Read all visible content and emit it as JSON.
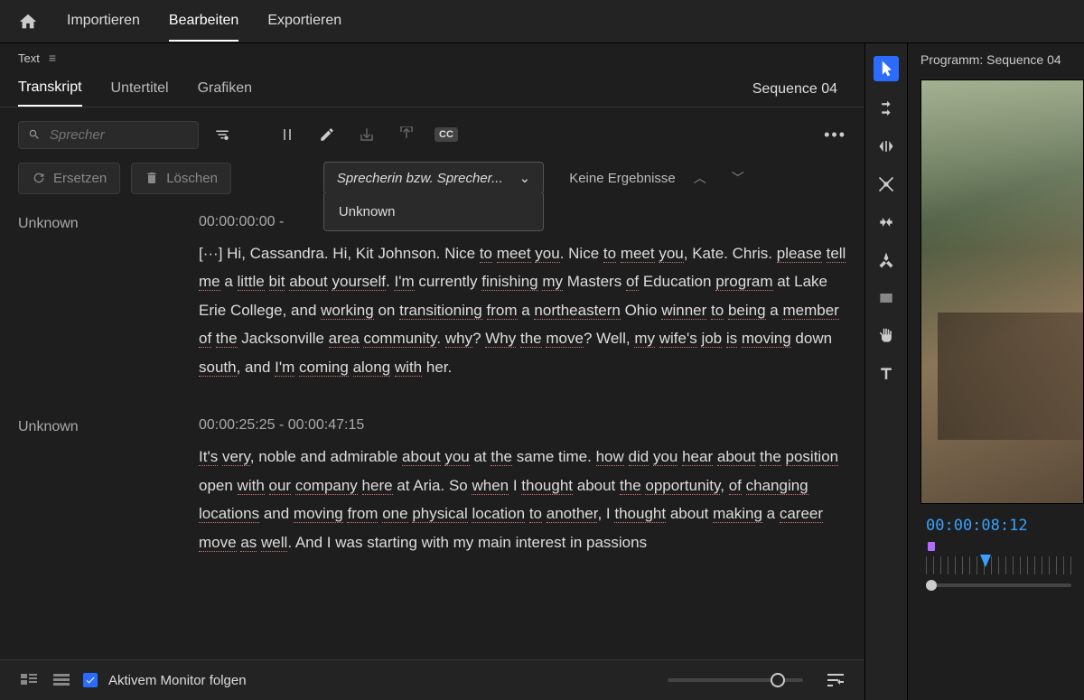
{
  "topbar": {
    "tabs": [
      "Importieren",
      "Bearbeiten",
      "Exportieren"
    ],
    "active": 1
  },
  "panel": {
    "title": "Text",
    "subtabs": [
      "Transkript",
      "Untertitel",
      "Grafiken"
    ],
    "active": 0,
    "sequence": "Sequence 04"
  },
  "search": {
    "placeholder": "Sprecher"
  },
  "actions": {
    "replace": "Ersetzen",
    "delete": "Löschen",
    "speaker_dropdown": "Sprecherin bzw. Sprecher...",
    "dropdown_items": [
      "Unknown"
    ],
    "results": "Keine Ergebnisse"
  },
  "transcript": [
    {
      "speaker": "Unknown",
      "timecode": "00:00:00:00 -",
      "text": "[···] Hi, Cassandra. Hi, Kit Johnson. Nice to meet you. Nice to meet you, Kate. Chris. please tell me a little bit about yourself. I'm currently finishing my Masters of Education program at Lake Erie College, and working on transitioning from a northeastern Ohio winner to being a member of the Jacksonville area community. why? Why the move? Well, my wife's job is moving down south, and I'm coming along with her."
    },
    {
      "speaker": "Unknown",
      "timecode": "00:00:25:25 - 00:00:47:15",
      "text": "It's very, noble and admirable about you at the same time. how did you hear about the position open with our company here at Aria. So when I thought about the opportunity, of changing locations and moving from one physical location to another, I thought about making a career move as well. And I was starting with my main interest in passions"
    }
  ],
  "footer": {
    "follow_label": "Aktivem Monitor folgen"
  },
  "program": {
    "title": "Programm: Sequence 04",
    "timecode": "00:00:08:12"
  }
}
